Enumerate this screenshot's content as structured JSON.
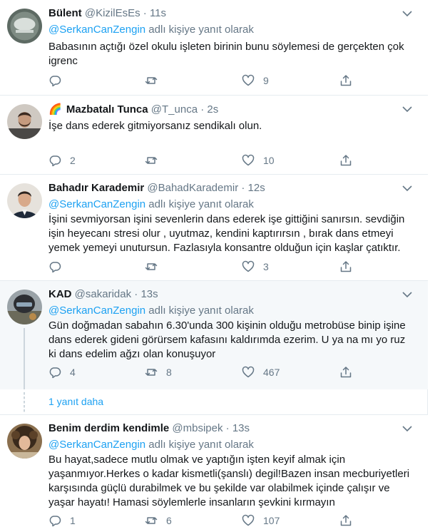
{
  "mention_prefix": "@SerkanCanZengin",
  "reply_suffix": " adlı kişiye yanıt olarak",
  "more_replies": "1 yanıt daha",
  "tweets": [
    {
      "name": "Bülent",
      "emoji": "",
      "handle": "@KizilEsEs",
      "time": "11s",
      "has_reply_to": true,
      "text": "Babasının açtığı özel okulu işleten birinin bunu söylemesi de gerçekten çok igrenc",
      "replies": "",
      "retweets": "",
      "likes": "9",
      "avatar": "logo-badge"
    },
    {
      "name": "Mazbatalı Tunca",
      "emoji": "🌈",
      "handle": "@T_unca",
      "time": "2s",
      "has_reply_to": false,
      "text": "İşe dans ederek gitmiyorsanız sendikalı olun.",
      "replies": "2",
      "retweets": "",
      "likes": "10",
      "avatar": "man-beard"
    },
    {
      "name": "Bahadır Karademir",
      "emoji": "",
      "handle": "@BahadKarademir",
      "time": "12s",
      "has_reply_to": true,
      "text": "İşini sevmiyorsan işini sevenlerin dans ederek işe gittiğini sanırsın. sevdiğin işin heyecanı stresi olur , uyutmaz, kendini kaptırırsın , bırak dans etmeyi yemek yemeyi unutursun. Fazlasıyla konsantre olduğun için kaşlar çatıktır.",
      "replies": "",
      "retweets": "",
      "likes": "3",
      "avatar": "man-suit"
    },
    {
      "name": "KAD",
      "emoji": "",
      "handle": "@sakaridak",
      "time": "13s",
      "has_reply_to": true,
      "text": "Gün doğmadan sabahın 6.30'unda 300 kişinin olduğu metrobüse binip işine dans ederek gideni görürsem kafasını kaldırımda ezerim. U ya na mı yo ruz ki dans edelim ağzı olan konuşuyor",
      "replies": "4",
      "retweets": "8",
      "likes": "467",
      "avatar": "helmet"
    },
    {
      "name": "Benim derdim kendimle",
      "emoji": "",
      "handle": "@mbsipek",
      "time": "13s",
      "has_reply_to": true,
      "text": "Bu hayat,sadece mutlu olmak ve yaptığın işten keyif almak için yaşanmıyor.Herkes o kadar kismetli(şanslı) degil!Bazen insan mecburiyetleri karşısında güçlü durabilmek ve bu şekilde var olabilmek içinde çalışır ve yaşar hayatı! Hamasi söylemlerle insanların şevkini kırmayın",
      "replies": "1",
      "retweets": "6",
      "likes": "107",
      "avatar": "woman-curly"
    }
  ]
}
